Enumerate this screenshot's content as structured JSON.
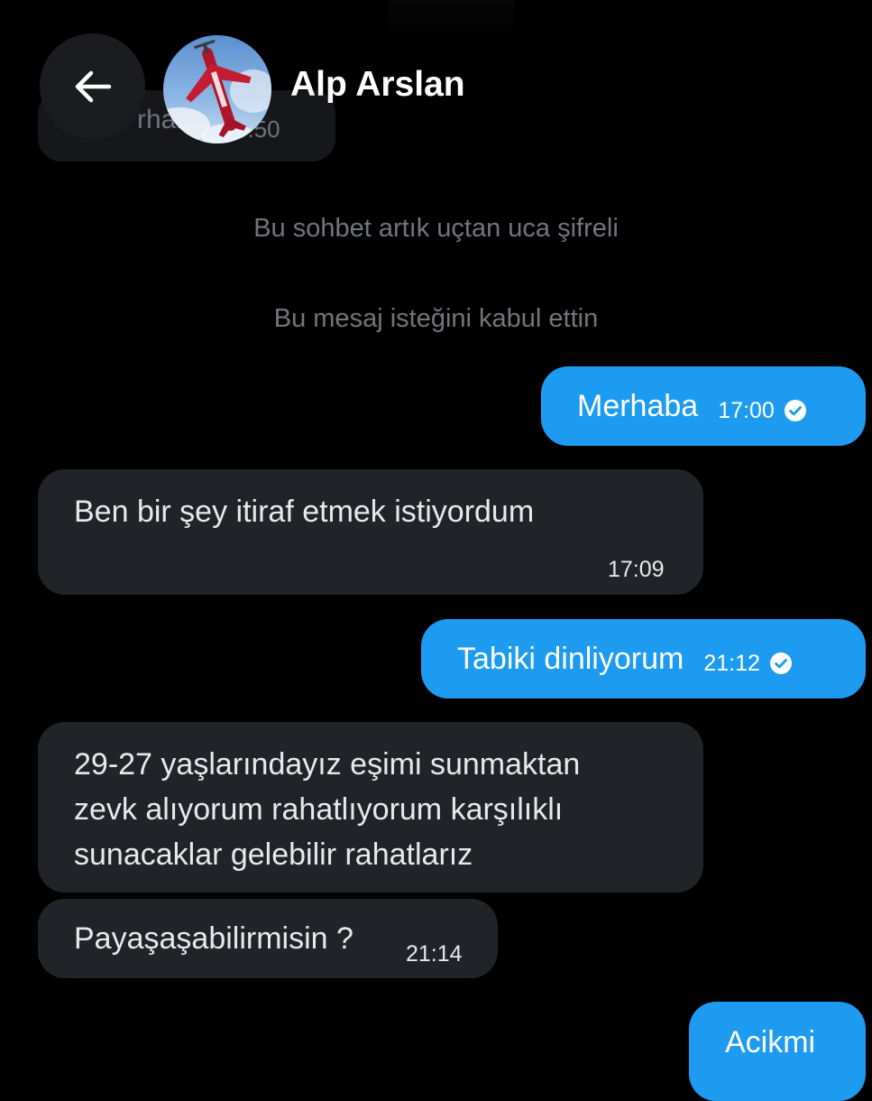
{
  "header": {
    "back_icon": "arrow-left-icon",
    "contact_name": "Alp Arslan",
    "avatar": "aircraft-photo-avatar"
  },
  "partial_message": {
    "text": "rhaba",
    "time": "3:50"
  },
  "notices": [
    "Bu sohbet artık uçtan uca şifreli",
    "Bu mesaj isteğini kabul ettin"
  ],
  "messages": [
    {
      "direction": "outgoing",
      "text": "Merhaba",
      "time": "17:00",
      "status_icon": "check-circle-icon"
    },
    {
      "direction": "incoming",
      "text": "Ben bir şey itiraf etmek istiyordum",
      "time": "17:09"
    },
    {
      "direction": "outgoing",
      "text": "Tabiki dinliyorum",
      "time": "21:12",
      "status_icon": "check-circle-icon"
    },
    {
      "direction": "incoming",
      "lines": [
        "29-27 yaşlarındayız eşimi sunmaktan",
        "zevk alıyorum rahatlıyorum karşılıklı",
        "sunacaklar gelebilir rahatlarız"
      ]
    },
    {
      "direction": "incoming",
      "text": "Payaşaşabilirmisin ?",
      "time": "21:14"
    },
    {
      "direction": "outgoing",
      "text": "Acikmi"
    }
  ],
  "colors": {
    "background": "#000000",
    "outgoing_bubble": "#1d9bf0",
    "incoming_bubble": "#202327",
    "notice_text": "#71767b"
  }
}
